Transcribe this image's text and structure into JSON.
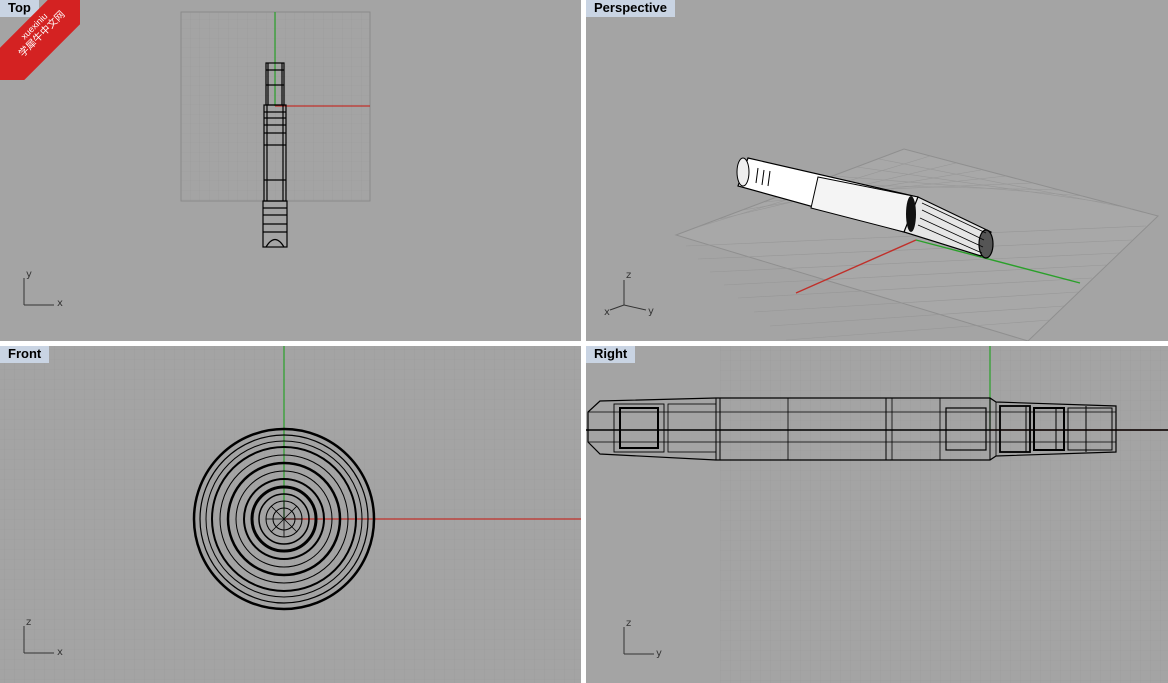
{
  "viewports": {
    "top": {
      "label": "Top",
      "axis_h": "x",
      "axis_v": "y"
    },
    "perspective": {
      "label": "Perspective",
      "axis_up": "z",
      "axis_a": "x",
      "axis_b": "y"
    },
    "front": {
      "label": "Front",
      "axis_h": "x",
      "axis_v": "z"
    },
    "right": {
      "label": "Right",
      "axis_h": "y",
      "axis_v": "z"
    }
  },
  "watermark": {
    "line1": "xuexiniu",
    "line2": "学犀牛中文网"
  },
  "colors": {
    "viewport_bg": "#a4a4a4",
    "grid_minor": "#999999",
    "grid_major": "#8a8a8a",
    "x_axis": "#c0302a",
    "y_axis": "#2aa02a",
    "label_bg": "#c9d4e3",
    "badge": "#d42222"
  }
}
